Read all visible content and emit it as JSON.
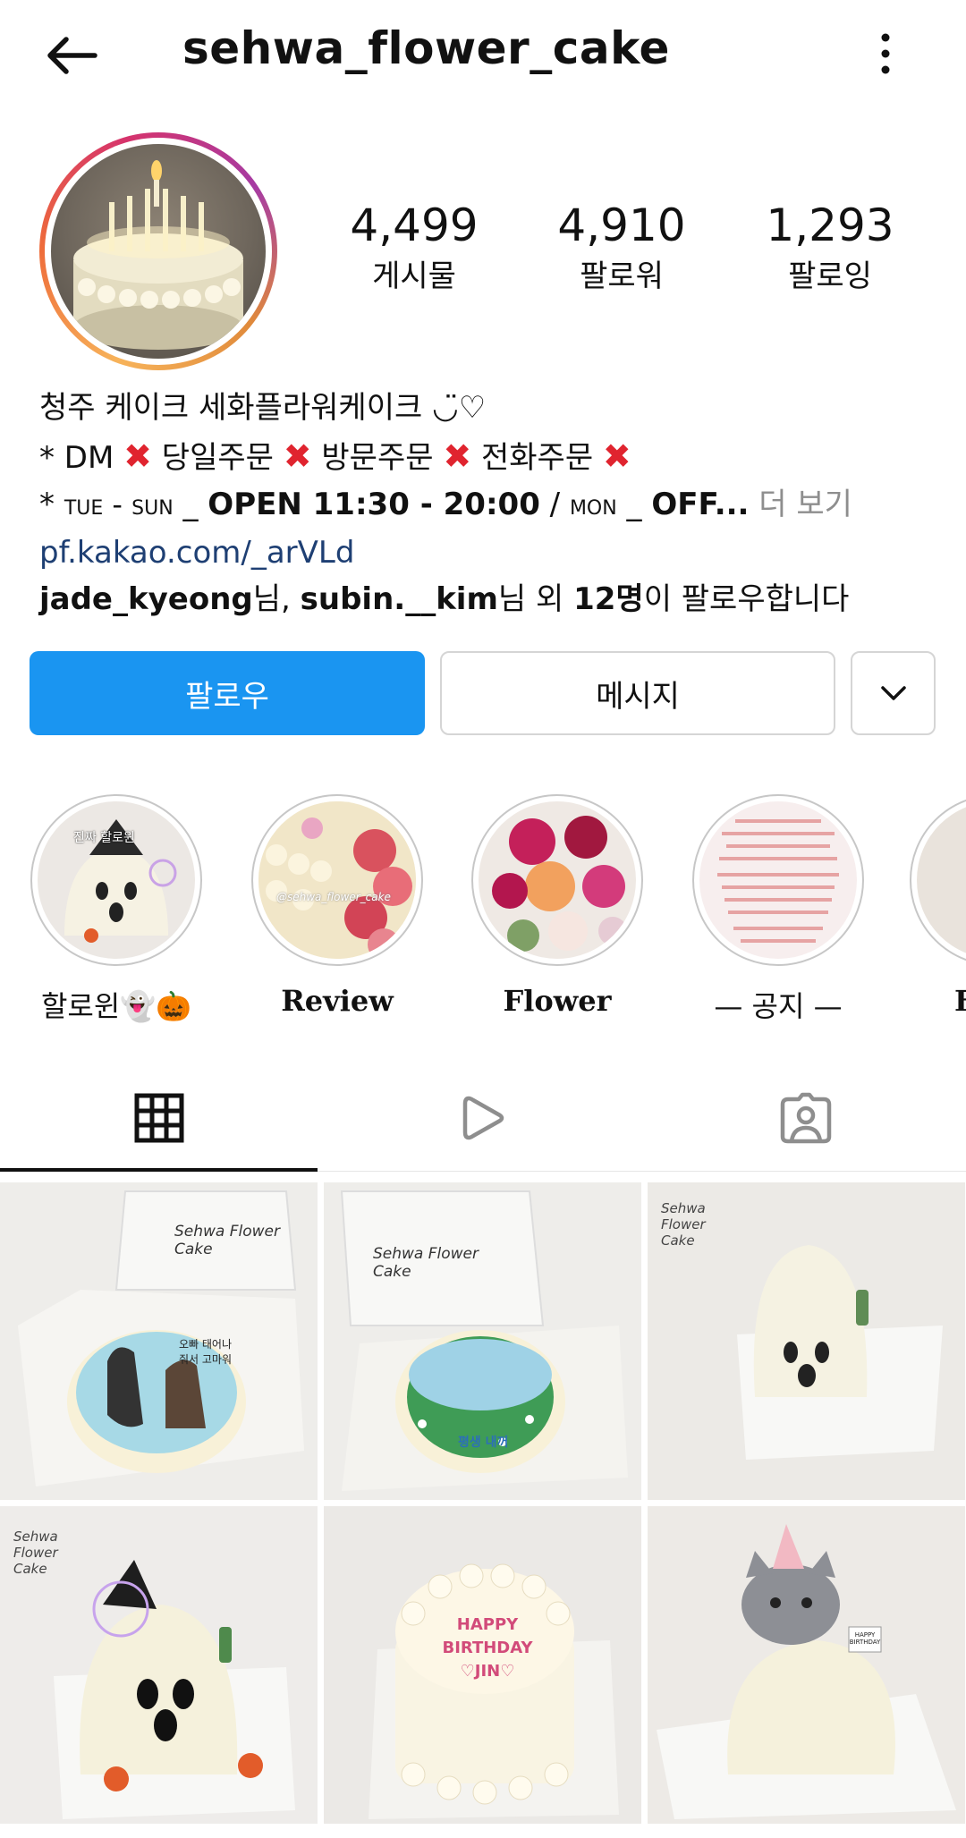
{
  "header": {
    "username": "sehwa_flower_cake",
    "back_icon": "arrow-left-icon",
    "more_icon": "vertical-dots-icon"
  },
  "stats": [
    {
      "value": "4,499",
      "label": "게시물"
    },
    {
      "value": "4,910",
      "label": "팔로워"
    },
    {
      "value": "1,293",
      "label": "팔로잉"
    }
  ],
  "bio": {
    "line1": "청주 케이크 세화플라워케이크 ◡̈♡",
    "line2_prefix": "* DM",
    "line2_items": [
      "당일주문",
      "방문주문",
      "전화주문"
    ],
    "line3_star": "*",
    "line3_days1": "tue - sun",
    "line3_sep1": " _ ",
    "line3_open": "OPEN 11:30 - 20:00",
    "line3_slash": " / ",
    "line3_days2": "mon",
    "line3_sep2": " _ ",
    "line3_off": "OFF...",
    "more_label": " 더 보기",
    "link": "pf.kakao.com/_arVLd",
    "followed_by_user1": "jade_kyeong",
    "followed_by_mid1": "님, ",
    "followed_by_user2": "subin.__kim",
    "followed_by_mid2": "님 외 ",
    "followed_by_count": "12명",
    "followed_by_suffix": "이 팔로우합니다"
  },
  "buttons": {
    "follow_label": "팔로우",
    "message_label": "메시지",
    "dropdown_icon": "chevron-down-icon"
  },
  "highlights": [
    {
      "label": "할로윈👻🎃",
      "overlay": "진짜 할로윈"
    },
    {
      "label": "Review",
      "overlay": "@sehwa_flower_cake"
    },
    {
      "label": "Flower"
    },
    {
      "label": "— 공지 —"
    },
    {
      "label": "F"
    }
  ],
  "tabs": [
    {
      "icon": "grid-icon",
      "active": true
    },
    {
      "icon": "reels-play-icon",
      "active": false
    },
    {
      "icon": "tagged-person-icon",
      "active": false
    }
  ],
  "grid": [
    {
      "box_label": "Sehwa Flower Cake",
      "cake_text": "오빠 태어나줘서 고마워"
    },
    {
      "box_label": "Sehwa Flower Cake",
      "cake_text": "평생 내꺼"
    },
    {
      "box_label": "Sehwa Flower Cake"
    },
    {
      "box_label": "Sehwa Flower Cake"
    },
    {
      "cake_text": "HAPPY BIRTHDAY ♡JIN♡"
    },
    {
      "cake_text": "HAPPY BIRTHDAY"
    }
  ],
  "colors": {
    "accent_blue": "#1a95f1",
    "cross_red": "#e0242f",
    "link_blue": "#1e3f73",
    "muted_gray": "#8e8e8e"
  }
}
